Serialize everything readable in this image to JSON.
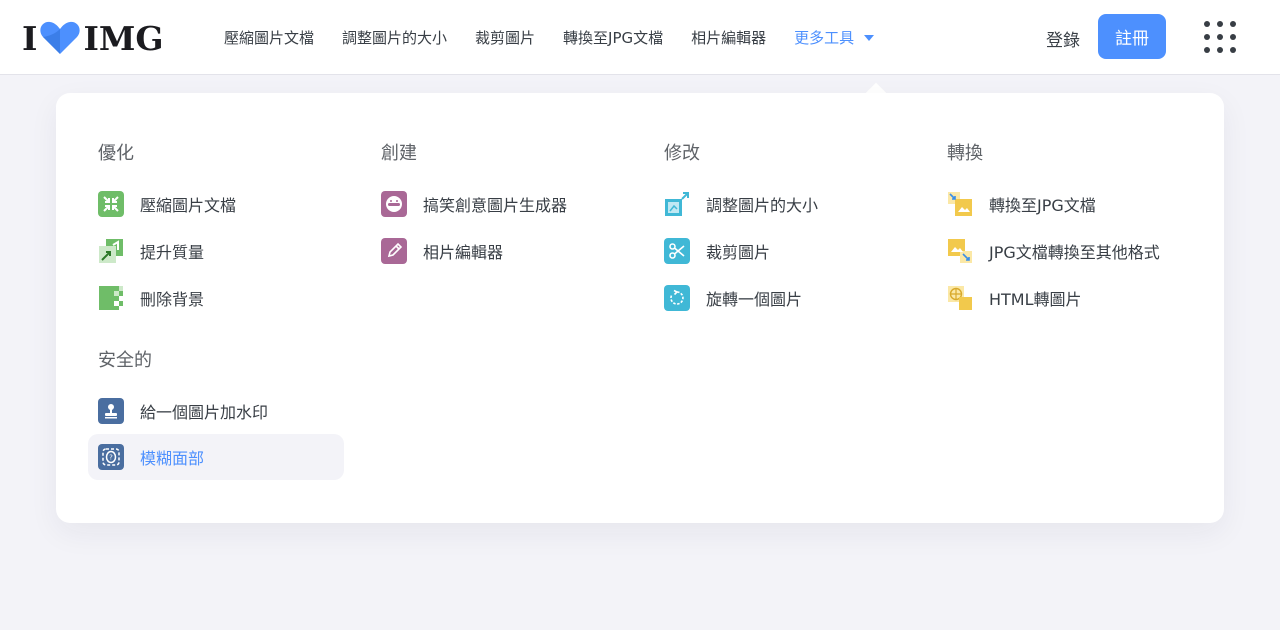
{
  "header": {
    "logo_left": "I",
    "logo_right": "IMG",
    "nav": [
      {
        "label": "壓縮圖片文檔"
      },
      {
        "label": "調整圖片的大小"
      },
      {
        "label": "裁剪圖片"
      },
      {
        "label": "轉換至JPG文檔"
      },
      {
        "label": "相片編輯器"
      }
    ],
    "more_label": "更多工具",
    "login_label": "登錄",
    "signup_label": "註冊"
  },
  "menu": {
    "optimize": {
      "title": "優化",
      "items": [
        {
          "label": "壓縮圖片文檔",
          "icon": "compress-icon"
        },
        {
          "label": "提升質量",
          "icon": "upscale-icon"
        },
        {
          "label": "刪除背景",
          "icon": "remove-background-icon"
        }
      ]
    },
    "security": {
      "title": "安全的",
      "items": [
        {
          "label": "給一個圖片加水印",
          "icon": "watermark-stamp-icon"
        },
        {
          "label": "模糊面部",
          "icon": "blur-face-icon"
        }
      ]
    },
    "create": {
      "title": "創建",
      "items": [
        {
          "label": "搞笑創意圖片生成器",
          "icon": "meme-generator-icon"
        },
        {
          "label": "相片編輯器",
          "icon": "photo-editor-icon"
        }
      ]
    },
    "edit": {
      "title": "修改",
      "items": [
        {
          "label": "調整圖片的大小",
          "icon": "resize-icon"
        },
        {
          "label": "裁剪圖片",
          "icon": "crop-scissors-icon"
        },
        {
          "label": "旋轉一個圖片",
          "icon": "rotate-icon"
        }
      ]
    },
    "convert": {
      "title": "轉換",
      "items": [
        {
          "label": "轉換至JPG文檔",
          "icon": "convert-to-jpg-icon"
        },
        {
          "label": "JPG文檔轉換至其他格式",
          "icon": "convert-from-jpg-icon"
        },
        {
          "label": "HTML轉圖片",
          "icon": "html-to-image-icon"
        }
      ]
    }
  },
  "colors": {
    "accent": "#4d90fe",
    "optimize": "#6fbd68",
    "create": "#a96896",
    "edit": "#40b8d6",
    "convert": "#f2c94c",
    "security": "#4a6ea0"
  }
}
